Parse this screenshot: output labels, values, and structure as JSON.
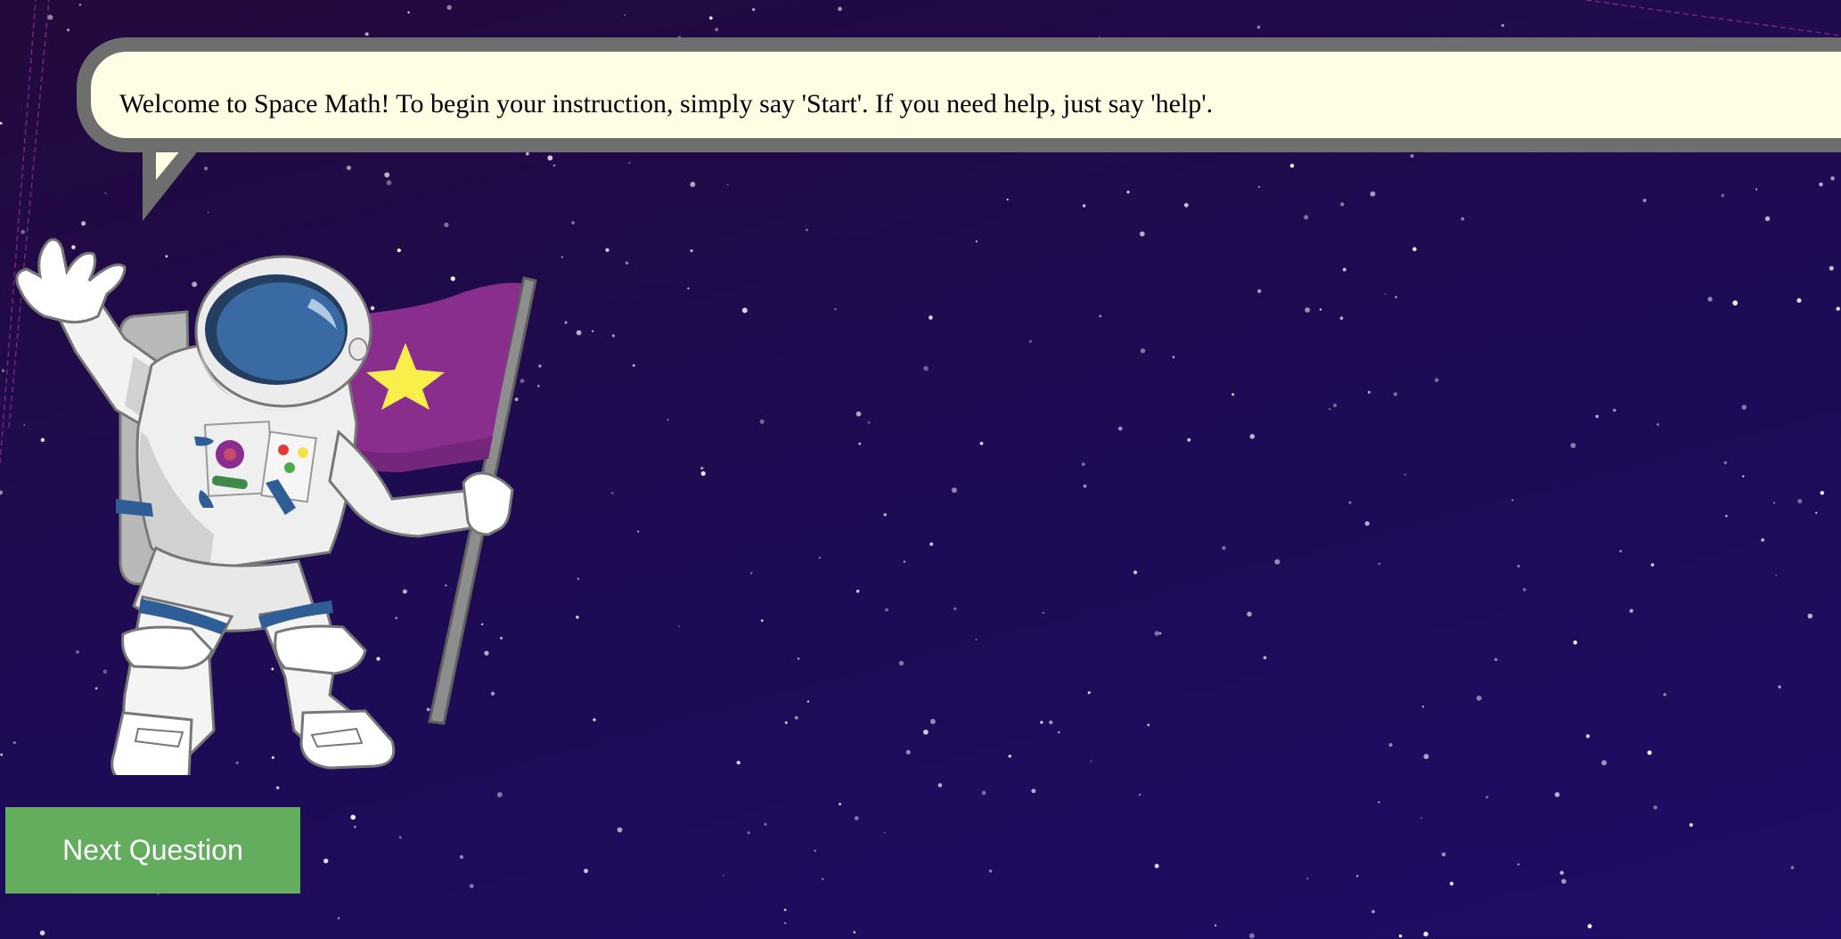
{
  "speech_bubble": {
    "text": "Welcome to Space Math! To begin your instruction, simply say 'Start'. If you need help, just say 'help'."
  },
  "mascot": {
    "icon": "astronaut-with-flag-icon",
    "flag_color": "#8a2e8e",
    "star_color": "#f9ee4a",
    "visor_color": "#3a6aa3"
  },
  "controls": {
    "next_label": "Next Question",
    "next_color": "#64ad5f"
  },
  "theme": {
    "background_top": "#230a3c",
    "background_bottom": "#1f0c66",
    "bubble_fill": "#fffde4",
    "bubble_border": "#6e6e6e"
  }
}
